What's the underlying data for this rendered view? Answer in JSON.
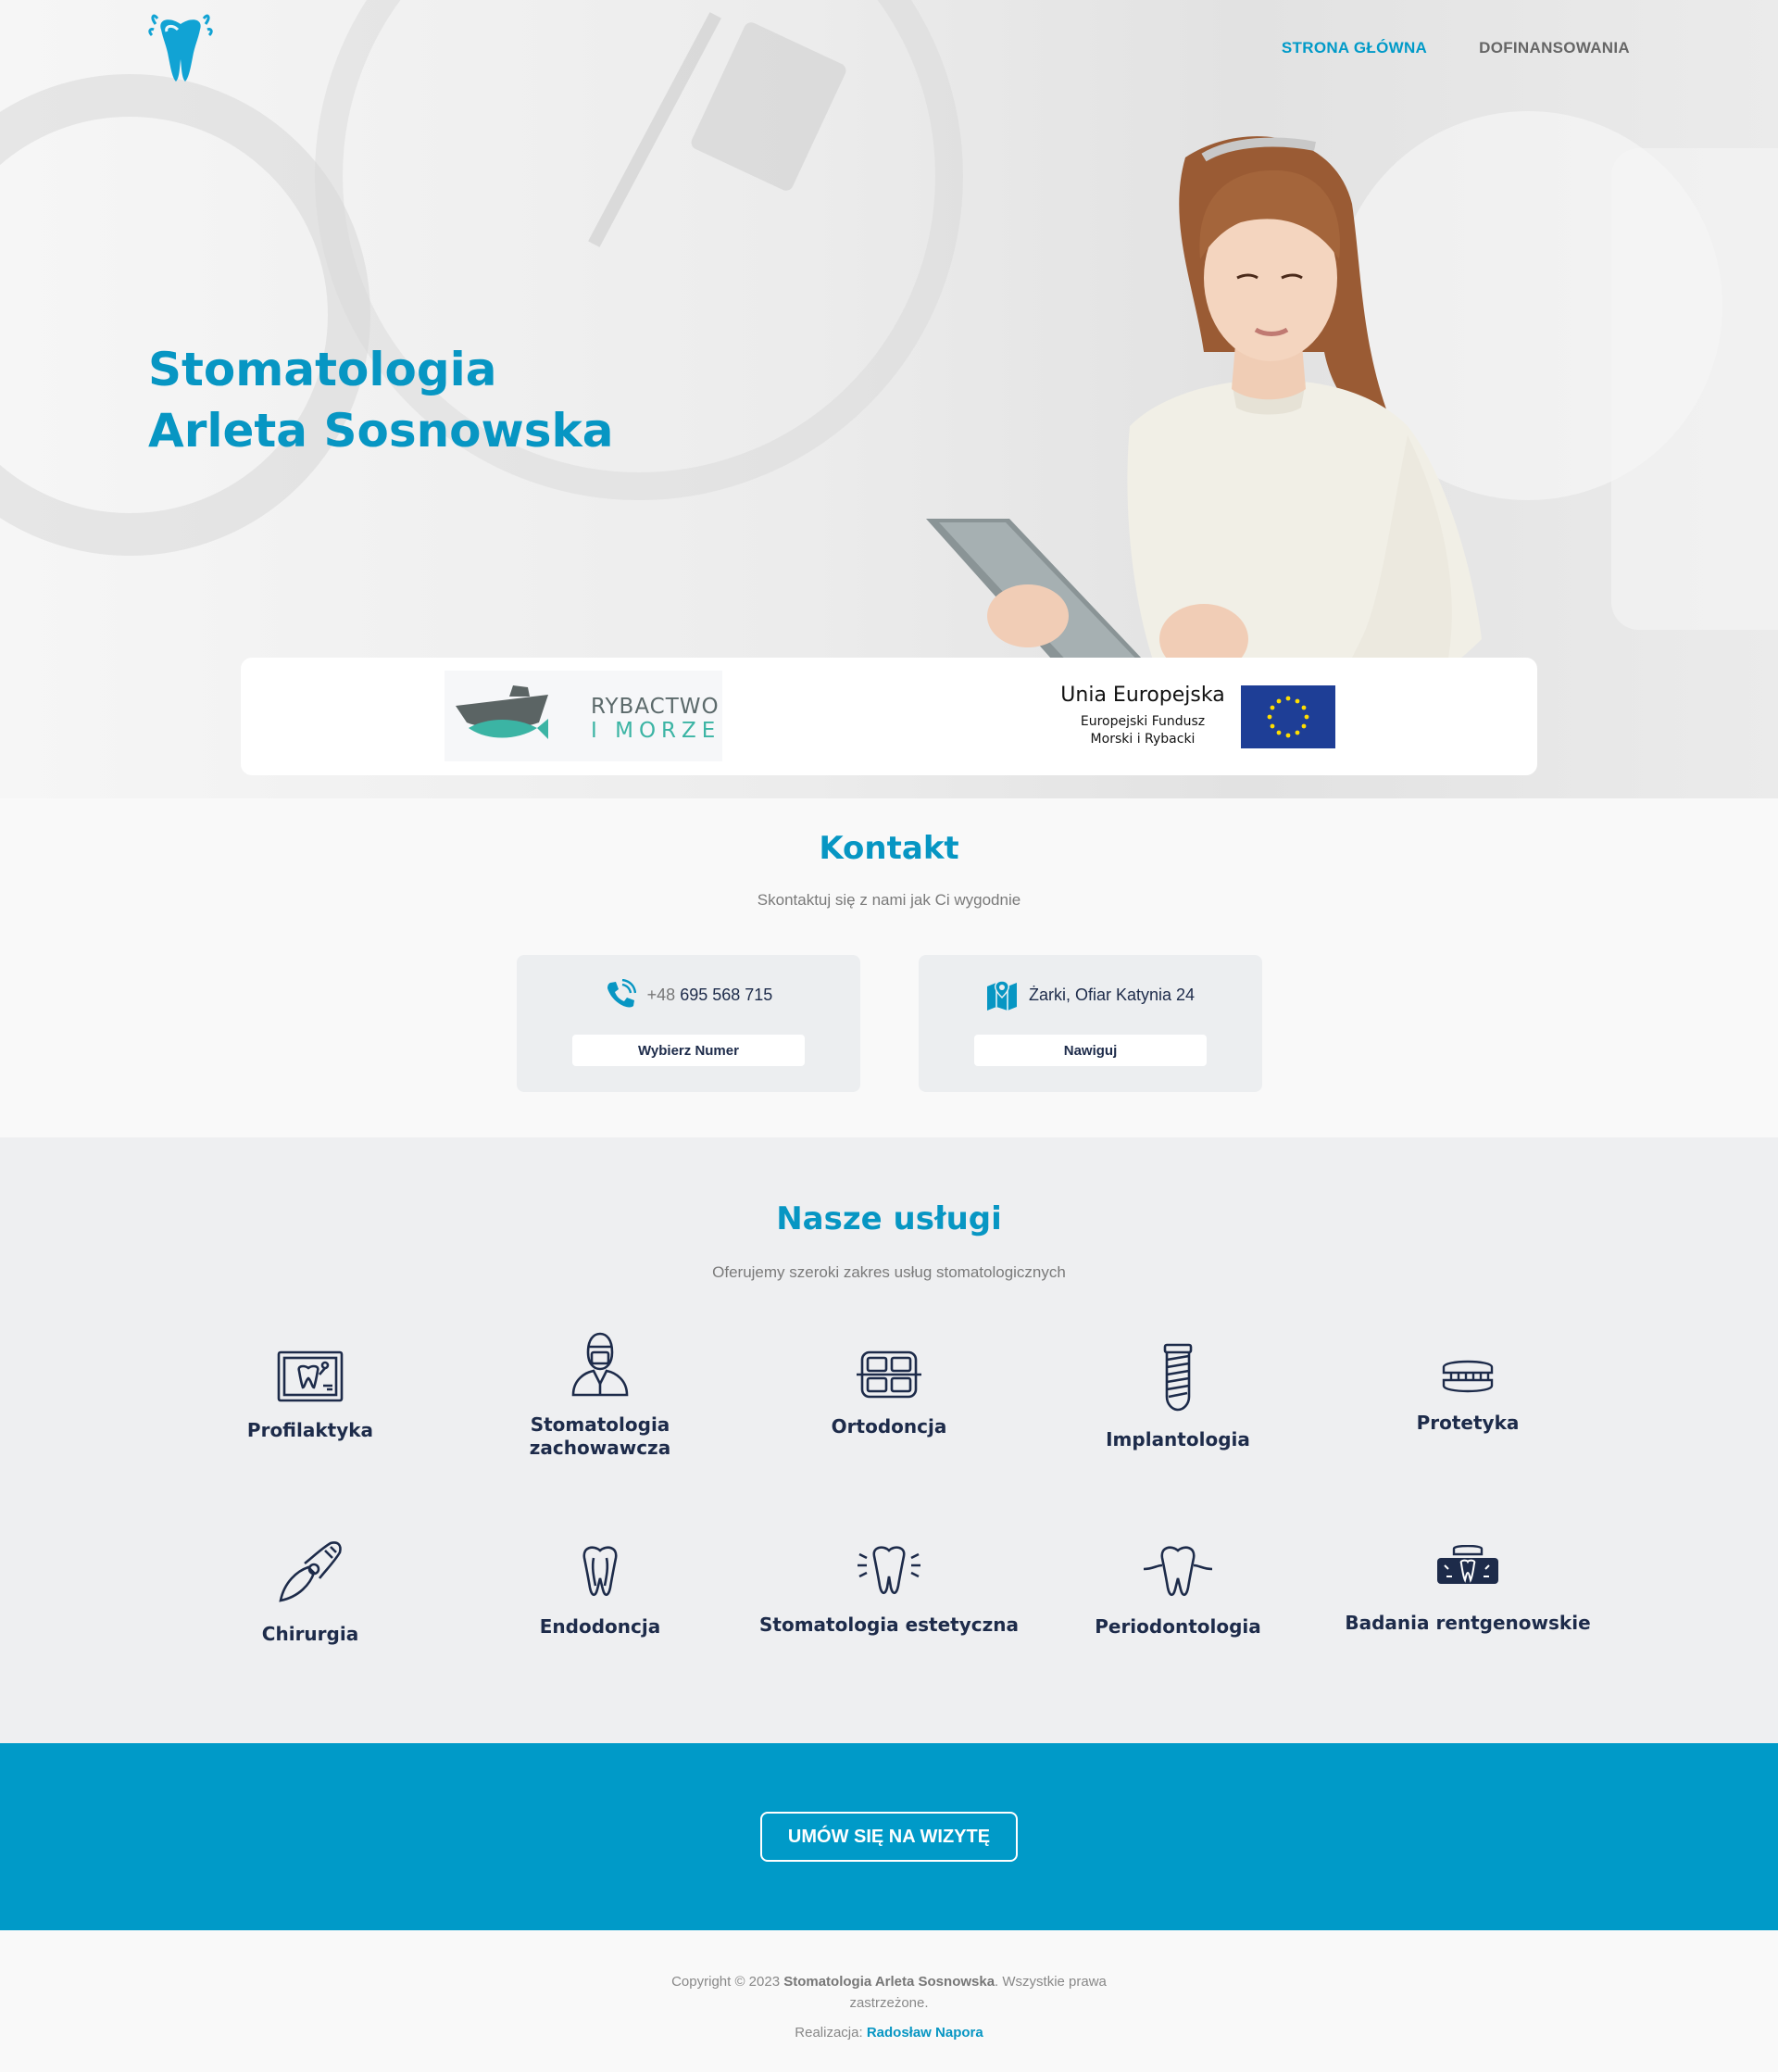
{
  "brand": {
    "logo_icon": "tooth-logo-icon",
    "accent": "#0796c3",
    "cta_bg": "#009ac8",
    "dark": "#1d2b4a"
  },
  "nav": {
    "items": [
      {
        "label": "STRONA GŁÓWNA",
        "active": true
      },
      {
        "label": "DOFINANSOWANIA",
        "active": false
      }
    ]
  },
  "hero": {
    "title_line1": "Stomatologia",
    "title_line2": "Arleta Sosnowska"
  },
  "partners": {
    "rybactwo": {
      "line1": "RYBACTWO",
      "line2": "I MORZE"
    },
    "eu": {
      "title": "Unia Europejska",
      "sub_line1": "Europejski Fundusz",
      "sub_line2": "Morski i Rybacki"
    }
  },
  "contact": {
    "title": "Kontakt",
    "subtitle": "Skontaktuj się z nami jak Ci wygodnie",
    "phone": {
      "icon": "phone-icon",
      "prefix": "+48",
      "number": "695 568 715",
      "button": "Wybierz Numer"
    },
    "address": {
      "icon": "map-pin-icon",
      "text": "Żarki, Ofiar Katynia 24",
      "button": "Nawiguj"
    }
  },
  "services": {
    "title": "Nasze usługi",
    "subtitle": "Oferujemy szeroki zakres usług stomatologicznych",
    "items": [
      {
        "label_line1": "Profilaktyka",
        "label_line2": "",
        "icon": "xray-board-icon"
      },
      {
        "label_line1": "Stomatologia",
        "label_line2": "zachowawcza",
        "icon": "dentist-icon"
      },
      {
        "label_line1": "Ortodoncja",
        "label_line2": "",
        "icon": "braces-icon"
      },
      {
        "label_line1": "Implantologia",
        "label_line2": "",
        "icon": "implant-icon"
      },
      {
        "label_line1": "Protetyka",
        "label_line2": "",
        "icon": "denture-icon"
      },
      {
        "label_line1": "Chirurgia",
        "label_line2": "",
        "icon": "forceps-icon"
      },
      {
        "label_line1": "Endodoncja",
        "label_line2": "",
        "icon": "tooth-root-icon"
      },
      {
        "label_line1": "Stomatologia estetyczna",
        "label_line2": "",
        "icon": "shiny-tooth-icon"
      },
      {
        "label_line1": "Periodontologia",
        "label_line2": "",
        "icon": "gum-tooth-icon"
      },
      {
        "label_line1": "Badania rentgenowskie",
        "label_line2": "",
        "icon": "panoramic-xray-icon"
      }
    ]
  },
  "cta": {
    "label": "UMÓW SIĘ NA WIZYTĘ"
  },
  "footer": {
    "copy_prefix": "Copyright © 2023 ",
    "copy_name": "Stomatologia Arleta Sosnowska",
    "copy_suffix": ". Wszystkie prawa zastrzeżone.",
    "credit_prefix": "Realizacja: ",
    "credit_author": "Radosław Napora"
  }
}
